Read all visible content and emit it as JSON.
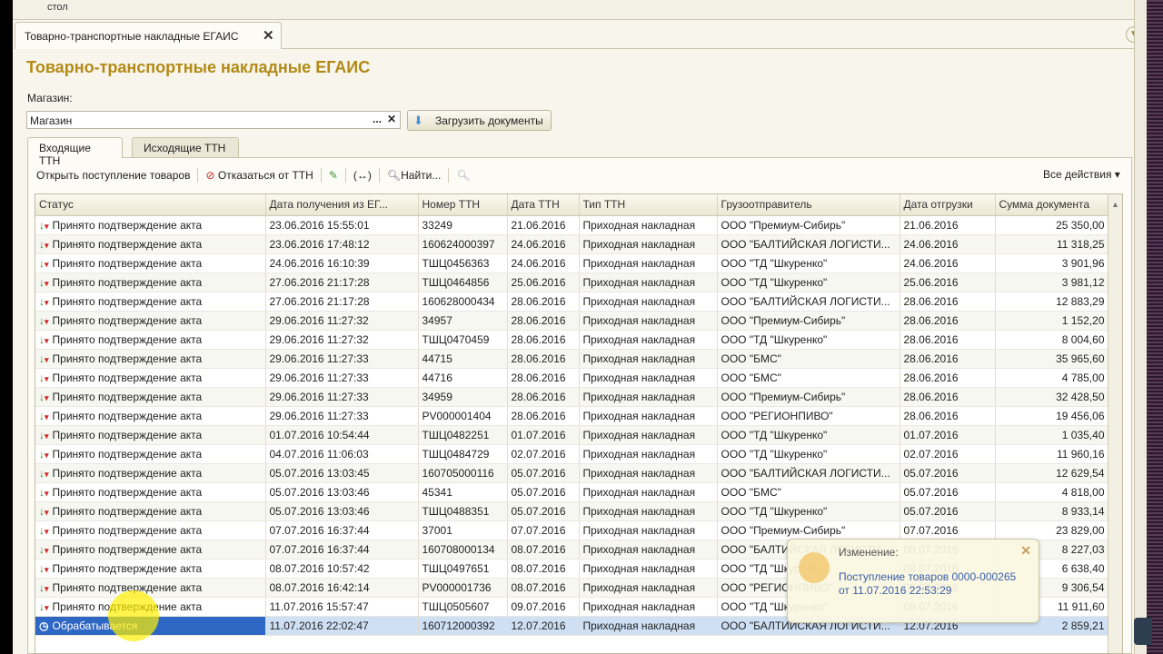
{
  "topbar": {
    "text": "стол"
  },
  "window_tab": {
    "label": "Товарно-транспортные накладные ЕГАИС"
  },
  "title": "Товарно-транспортные накладные ЕГАИС",
  "shop": {
    "label": "Магазин:",
    "value": "Магазин"
  },
  "load_button": "Загрузить документы",
  "tabs": [
    "Входящие ТТН",
    "Исходящие ТТН"
  ],
  "toolbar": {
    "open": "Открыть поступление товаров",
    "refuse": "Отказаться от ТТН",
    "find": "Найти...",
    "all_actions": "Все действия"
  },
  "columns": [
    "Статус",
    "Дата получения из ЕГ...",
    "Номер ТТН",
    "Дата ТТН",
    "Тип ТТН",
    "Грузоотправитель",
    "Дата отгрузки",
    "Сумма документа"
  ],
  "rows": [
    [
      "Принято подтверждение акта",
      "23.06.2016 15:55:01",
      "33249",
      "21.06.2016",
      "Приходная накладная",
      "ООО \"Премиум-Сибирь\"",
      "21.06.2016",
      "25 350,00"
    ],
    [
      "Принято подтверждение акта",
      "23.06.2016 17:48:12",
      "160624000397",
      "24.06.2016",
      "Приходная накладная",
      "ООО \"БАЛТИЙСКАЯ ЛОГИСТИ...",
      "24.06.2016",
      "11 318,25"
    ],
    [
      "Принято подтверждение акта",
      "24.06.2016 16:10:39",
      "ТШЦ0456363",
      "24.06.2016",
      "Приходная накладная",
      "ООО \"ТД \"Шкуренко\"",
      "24.06.2016",
      "3 901,96"
    ],
    [
      "Принято подтверждение акта",
      "27.06.2016 21:17:28",
      "ТШЦ0464856",
      "25.06.2016",
      "Приходная накладная",
      "ООО \"ТД \"Шкуренко\"",
      "25.06.2016",
      "3 981,12"
    ],
    [
      "Принято подтверждение акта",
      "27.06.2016 21:17:28",
      "160628000434",
      "28.06.2016",
      "Приходная накладная",
      "ООО \"БАЛТИЙСКАЯ ЛОГИСТИ...",
      "28.06.2016",
      "12 883,29"
    ],
    [
      "Принято подтверждение акта",
      "29.06.2016 11:27:32",
      "34957",
      "28.06.2016",
      "Приходная накладная",
      "ООО \"Премиум-Сибирь\"",
      "28.06.2016",
      "1 152,20"
    ],
    [
      "Принято подтверждение акта",
      "29.06.2016 11:27:32",
      "ТШЦ0470459",
      "28.06.2016",
      "Приходная накладная",
      "ООО \"ТД \"Шкуренко\"",
      "28.06.2016",
      "8 004,60"
    ],
    [
      "Принято подтверждение акта",
      "29.06.2016 11:27:33",
      "44715",
      "28.06.2016",
      "Приходная накладная",
      "ООО \"БМС\"",
      "28.06.2016",
      "35 965,60"
    ],
    [
      "Принято подтверждение акта",
      "29.06.2016 11:27:33",
      "44716",
      "28.06.2016",
      "Приходная накладная",
      "ООО \"БМС\"",
      "28.06.2016",
      "4 785,00"
    ],
    [
      "Принято подтверждение акта",
      "29.06.2016 11:27:33",
      "34959",
      "28.06.2016",
      "Приходная накладная",
      "ООО \"Премиум-Сибирь\"",
      "28.06.2016",
      "32 428,50"
    ],
    [
      "Принято подтверждение акта",
      "29.06.2016 11:27:33",
      "PV000001404",
      "28.06.2016",
      "Приходная накладная",
      "ООО \"РЕГИОНПИВО\"",
      "28.06.2016",
      "19 456,06"
    ],
    [
      "Принято подтверждение акта",
      "01.07.2016 10:54:44",
      "ТШЦ0482251",
      "01.07.2016",
      "Приходная накладная",
      "ООО \"ТД \"Шкуренко\"",
      "01.07.2016",
      "1 035,40"
    ],
    [
      "Принято подтверждение акта",
      "04.07.2016 11:06:03",
      "ТШЦ0484729",
      "02.07.2016",
      "Приходная накладная",
      "ООО \"ТД \"Шкуренко\"",
      "02.07.2016",
      "11 960,16"
    ],
    [
      "Принято подтверждение акта",
      "05.07.2016 13:03:45",
      "160705000116",
      "05.07.2016",
      "Приходная накладная",
      "ООО \"БАЛТИЙСКАЯ ЛОГИСТИ...",
      "05.07.2016",
      "12 629,54"
    ],
    [
      "Принято подтверждение акта",
      "05.07.2016 13:03:46",
      "45341",
      "05.07.2016",
      "Приходная накладная",
      "ООО \"БМС\"",
      "05.07.2016",
      "4 818,00"
    ],
    [
      "Принято подтверждение акта",
      "05.07.2016 13:03:46",
      "ТШЦ0488351",
      "05.07.2016",
      "Приходная накладная",
      "ООО \"ТД \"Шкуренко\"",
      "05.07.2016",
      "8 933,14"
    ],
    [
      "Принято подтверждение акта",
      "07.07.2016 16:37:44",
      "37001",
      "07.07.2016",
      "Приходная накладная",
      "ООО \"Премиум-Сибирь\"",
      "07.07.2016",
      "23 829,00"
    ],
    [
      "Принято подтверждение акта",
      "07.07.2016 16:37:44",
      "160708000134",
      "08.07.2016",
      "Приходная накладная",
      "ООО \"БАЛТИЙСКАЯ ЛОГИСТИ...",
      "08.07.2016",
      "8 227,03"
    ],
    [
      "Принято подтверждение акта",
      "08.07.2016 10:57:42",
      "ТШЦ0497651",
      "08.07.2016",
      "Приходная накладная",
      "ООО \"ТД \"Шкуренко\"",
      "08.07.2016",
      "6 638,40"
    ],
    [
      "Принято подтверждение акта",
      "08.07.2016 16:42:14",
      "PV000001736",
      "08.07.2016",
      "Приходная накладная",
      "ООО \"РЕГИОНПИВО\"",
      "08.07.2016",
      "9 306,54"
    ],
    [
      "Принято подтверждение акта",
      "11.07.2016 15:57:47",
      "ТШЦ0505607",
      "09.07.2016",
      "Приходная накладная",
      "ООО \"ТД \"Шкуренко\"",
      "09.07.2016",
      "11 911,60"
    ],
    [
      "Обрабатывается",
      "11.07.2016 22:02:47",
      "160712000392",
      "12.07.2016",
      "Приходная накладная",
      "ООО \"БАЛТИЙСКАЯ ЛОГИСТИ...",
      "12.07.2016",
      "2 859,21"
    ]
  ],
  "selected_row": 21,
  "notification": {
    "heading": "Изменение:",
    "link": "Поступление товаров 0000-000265",
    "date": "от 11.07.2016 22:53:29"
  },
  "colors": {
    "title": "#b48a16",
    "selection": "#2e66c4",
    "link": "#3b5ea8"
  }
}
